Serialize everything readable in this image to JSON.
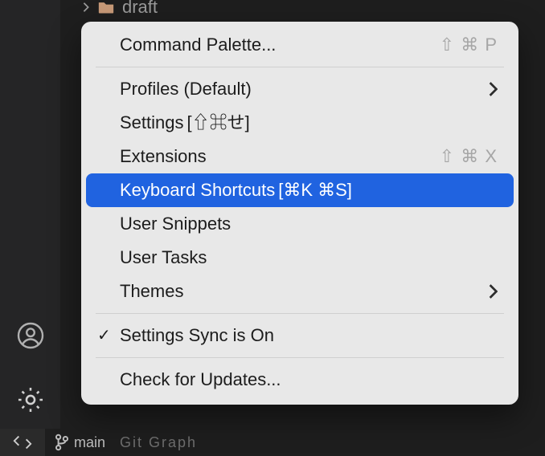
{
  "explorer": {
    "item_label": "draft"
  },
  "menu": {
    "command_palette": {
      "label": "Command Palette...",
      "shortcut": "⇧ ⌘ P"
    },
    "profiles": {
      "label": "Profiles (Default)"
    },
    "settings": {
      "label": "Settings",
      "inline_shortcut": "[⇧⌘せ]"
    },
    "extensions": {
      "label": "Extensions",
      "shortcut": "⇧ ⌘ X"
    },
    "keyboard_shortcuts": {
      "label": "Keyboard Shortcuts",
      "inline_shortcut": "[⌘K ⌘S]"
    },
    "user_snippets": {
      "label": "User Snippets"
    },
    "user_tasks": {
      "label": "User Tasks"
    },
    "themes": {
      "label": "Themes"
    },
    "settings_sync": {
      "label": "Settings Sync is On",
      "checked": true
    },
    "check_updates": {
      "label": "Check for Updates..."
    }
  },
  "statusbar": {
    "branch": "main",
    "trailing": "Git Graph"
  }
}
